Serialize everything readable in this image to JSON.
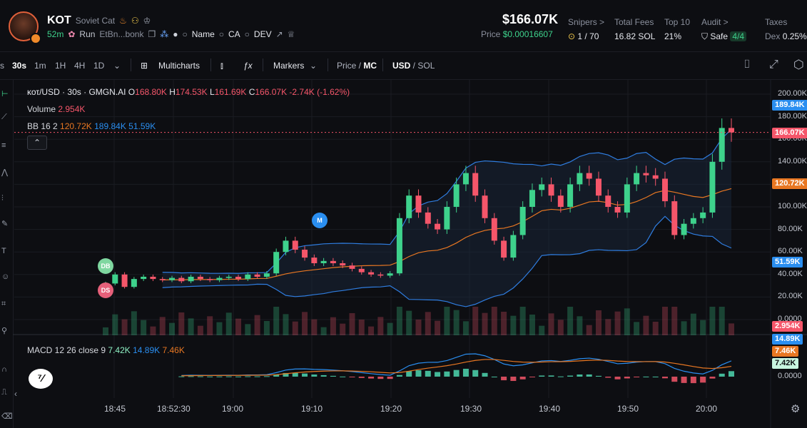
{
  "token": {
    "symbol": "KOT",
    "name": "Soviet Cat",
    "age": "52m",
    "run_label": "Run",
    "address": "EtBn...bonk",
    "links": {
      "name": "Name",
      "ca": "CA",
      "dev": "DEV"
    }
  },
  "price": {
    "usd": "$166.07K",
    "label": "Price",
    "value": "$0.00016607"
  },
  "stats": {
    "snipers": {
      "label": "Snipers >",
      "value": "1 / 70"
    },
    "total_fees": {
      "label": "Total Fees",
      "value": "16.82 SOL"
    },
    "top10": {
      "label": "Top 10",
      "value": "21%"
    },
    "audit": {
      "label": "Audit >",
      "value": "Safe",
      "badge": "4/4"
    },
    "taxes": {
      "label": "Taxes",
      "value_label": "Dex",
      "value": "0.25%"
    }
  },
  "toolbar": {
    "intervals": [
      "s",
      "30s",
      "1m",
      "1H",
      "4H",
      "1D"
    ],
    "active_interval": "30s",
    "multicharts": "Multicharts",
    "markers": "Markers",
    "price_mc": {
      "price": "Price",
      "mc": "MC"
    },
    "currency": {
      "usd": "USD",
      "sol": "SOL"
    }
  },
  "legend": {
    "title": "κοτ/USD · 30s · GMGN.AI",
    "o_label": "O",
    "o": "168.80K",
    "h_label": "H",
    "h": "174.53K",
    "l_label": "L",
    "l": "161.69K",
    "c_label": "C",
    "c": "166.07K",
    "change": "-2.74K (-1.62%)",
    "volume_label": "Volume",
    "volume": "2.954K",
    "bb_label": "BB 16 2",
    "bb_mid": "120.72K",
    "bb_upper": "189.84K",
    "bb_lower": "51.59K",
    "macd_label": "MACD 12 26 close 9",
    "macd_hist": "7.42K",
    "macd_line": "14.89K",
    "macd_signal": "7.46K"
  },
  "axis_tags": {
    "bb_upper": "189.84K",
    "last_price": "166.07K",
    "bb_mid": "120.72K",
    "bb_lower": "51.59K",
    "volume": "2.954K",
    "macd_line": "14.89K",
    "macd_signal": "7.46K",
    "macd_hist": "7.42K"
  },
  "markers": {
    "m": "M",
    "db": "DB",
    "ds": "DS"
  },
  "colors": {
    "up": "#3ed28c",
    "down": "#f5566a",
    "bb_band": "#2f7de0",
    "bb_mid": "#e87722",
    "accent_blue": "#2a8ef0",
    "bg": "#0d0e12"
  },
  "chart_data": {
    "type": "candlestick",
    "title": "κοτ/USD · 30s · GMGN.AI",
    "y_ticks": [
      "200.00K",
      "180.00K",
      "160.00K",
      "140.00K",
      "120.00K",
      "100.00K",
      "80.00K",
      "60.00K",
      "40.00K",
      "20.00K",
      "0.0000"
    ],
    "macd_ticks": [
      "0.0000"
    ],
    "x_ticks": [
      "18:45",
      "18:52:30",
      "19:00",
      "19:10",
      "19:20",
      "19:30",
      "19:40",
      "19:50",
      "20:00"
    ],
    "ylim": [
      0,
      200000
    ],
    "grid": true,
    "price_close_approx": [
      32000,
      40000,
      29000,
      36000,
      38000,
      36000,
      35000,
      37000,
      34000,
      38000,
      36000,
      35000,
      37000,
      38000,
      36000,
      40000,
      38000,
      41000,
      60000,
      70000,
      62000,
      55000,
      50000,
      52000,
      50000,
      48000,
      45000,
      42000,
      40000,
      39000,
      41000,
      90000,
      110000,
      95000,
      85000,
      80000,
      100000,
      120000,
      130000,
      110000,
      90000,
      70000,
      55000,
      75000,
      100000,
      115000,
      120000,
      110000,
      100000,
      120000,
      130000,
      125000,
      110000,
      100000,
      95000,
      120000,
      130000,
      128000,
      125000,
      105000,
      75000,
      85000,
      90000,
      95000,
      140000,
      170000,
      166070
    ],
    "bollinger": {
      "period": 16,
      "stddev": 2,
      "upper_last": 189840,
      "mid_last": 120720,
      "lower_last": 51590
    },
    "volume_last": 2954,
    "macd": {
      "fast": 12,
      "slow": 26,
      "line_last": 14890,
      "signal_last": 7460,
      "hist_last": 7420
    }
  }
}
